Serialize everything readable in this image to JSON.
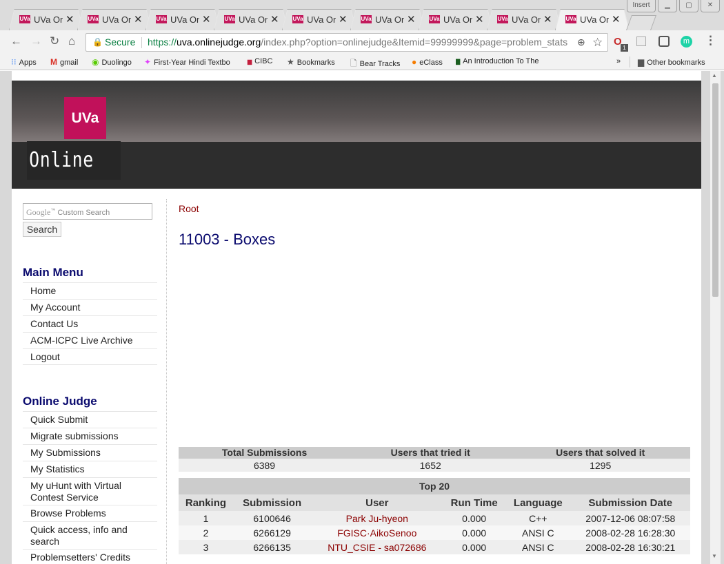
{
  "browser": {
    "tabs": [
      {
        "title": "UVa Online Judge",
        "favicon": "UVa",
        "active": false
      },
      {
        "title": "UVa Online Judge",
        "favicon": "UVa",
        "active": false
      },
      {
        "title": "UVa Online Judge",
        "favicon": "UVa",
        "active": false
      },
      {
        "title": "UVa Online Judge",
        "favicon": "UVa",
        "active": false
      },
      {
        "title": "UVa Online Judge",
        "favicon": "UVa",
        "active": false
      },
      {
        "title": "UVa Online Judge",
        "favicon": "UVa",
        "active": false
      },
      {
        "title": "UVa Online Judge",
        "favicon": "UVa",
        "active": false
      },
      {
        "title": "UVa Online Judge",
        "favicon": "UVa",
        "active": false
      },
      {
        "title": "UVa Online Judge",
        "favicon": "UVa",
        "active": true
      }
    ],
    "window_badge": "Insert",
    "security_label": "Secure",
    "url_scheme": "https://",
    "url_host": "uva.onlinejudge.org",
    "url_rest": "/index.php?option=onlinejudge&Itemid=99999999&page=problem_stats",
    "extension_badge": "1",
    "profile_initial": "m",
    "bookmarks": [
      {
        "label": "Apps",
        "icon": "apps-grid-icon"
      },
      {
        "label": "gmail",
        "icon": "gmail-icon"
      },
      {
        "label": "Duolingo",
        "icon": "duolingo-icon"
      },
      {
        "label": "First-Year Hindi Textbo",
        "icon": "hindi-book-icon"
      },
      {
        "label": "CIBC",
        "icon": "cibc-icon"
      },
      {
        "label": "Bookmarks",
        "icon": "star-icon"
      },
      {
        "label": "Bear Tracks",
        "icon": "page-icon"
      },
      {
        "label": "eClass",
        "icon": "eclass-icon"
      },
      {
        "label": "An Introduction To The",
        "icon": "sql-icon"
      }
    ],
    "more_bookmarks": "»",
    "other_bookmarks": "Other bookmarks"
  },
  "site": {
    "logo_text": "UVa",
    "brand": "Online Judge",
    "search_placeholder": "Custom Search",
    "search_google": "Google",
    "search_button": "Search",
    "main_menu_title": "Main Menu",
    "main_menu": [
      "Home",
      "My Account",
      "Contact Us",
      "ACM-ICPC Live Archive",
      "Logout"
    ],
    "oj_menu_title": "Online Judge",
    "oj_menu": [
      "Quick Submit",
      "Migrate submissions",
      "My Submissions",
      "My Statistics",
      "My uHunt with Virtual Contest Service",
      "Browse Problems",
      "Quick access, info and search",
      "Problemsetters' Credits"
    ]
  },
  "content": {
    "breadcrumb": "Root",
    "problem_title": "11003 - Boxes",
    "stats": {
      "headers": [
        "Total Submissions",
        "Users that tried it",
        "Users that solved it"
      ],
      "values": [
        "6389",
        "1652",
        "1295"
      ]
    },
    "top20": {
      "caption": "Top 20",
      "headers": [
        "Ranking",
        "Submission",
        "User",
        "Run Time",
        "Language",
        "Submission Date"
      ],
      "rows": [
        [
          "1",
          "6100646",
          "Park Ju-hyeon",
          "0.000",
          "C++",
          "2007-12-06 08:07:58"
        ],
        [
          "2",
          "6266129",
          "FGISC·AikoSenoo",
          "0.000",
          "ANSI C",
          "2008-02-28 16:28:30"
        ],
        [
          "3",
          "6266135",
          "NTU_CSIE - sa072686",
          "0.000",
          "ANSI C",
          "2008-02-28 16:30:21"
        ]
      ]
    }
  }
}
